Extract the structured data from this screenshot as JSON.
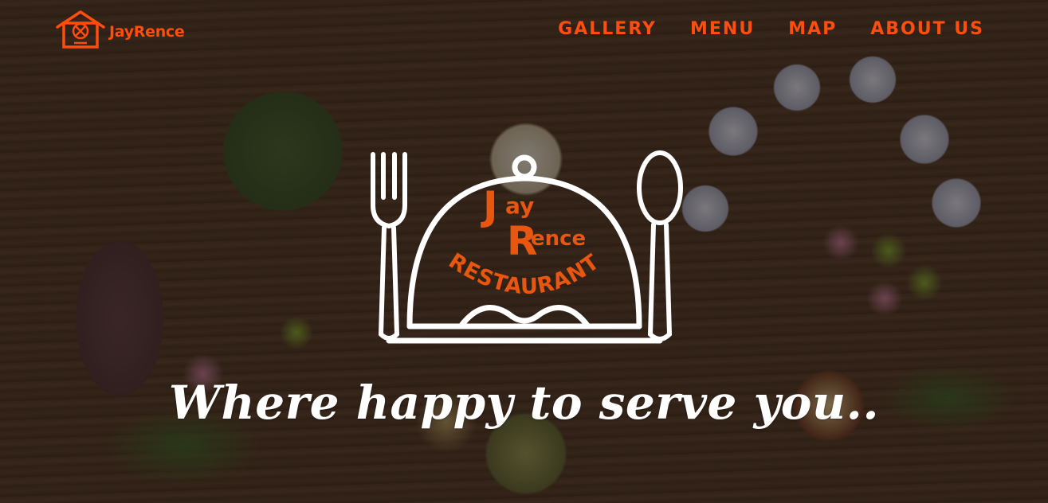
{
  "brand": {
    "name": "JayRence",
    "icon": "house-restaurant-icon",
    "color": "#ff4d0d"
  },
  "nav": {
    "items": [
      {
        "label": "GALLERY"
      },
      {
        "label": "MENU"
      },
      {
        "label": "MAP"
      },
      {
        "label": "ABOUT US"
      }
    ]
  },
  "hero": {
    "logo": {
      "line1_big": "J",
      "line1_small": "ay",
      "line2_big": "R",
      "line2_small": "ence",
      "line3": "RESTAURANT",
      "icon": "cloche-fork-spoon-icon"
    },
    "tagline": "Where happy to serve you.."
  },
  "colors": {
    "accent": "#ff4d0d",
    "logo_text": "#e8560f",
    "white": "#ffffff"
  }
}
